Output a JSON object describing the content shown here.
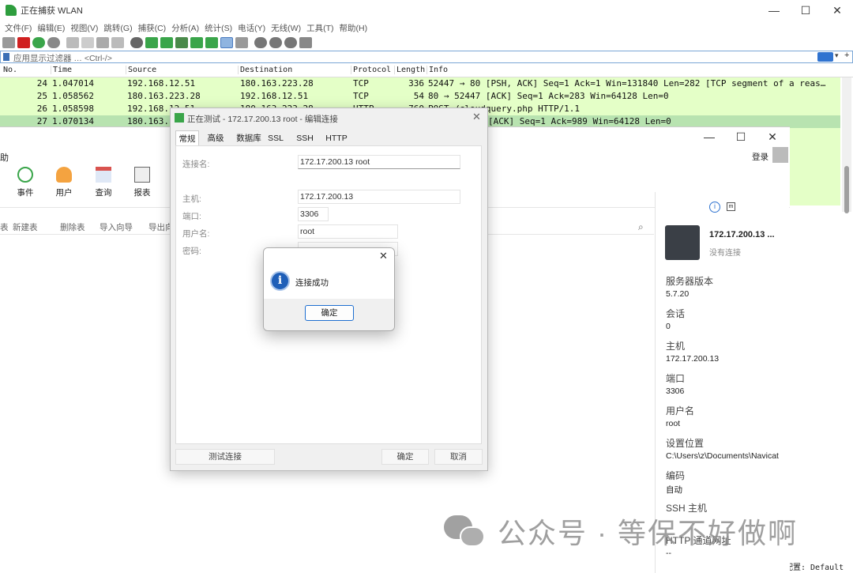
{
  "wireshark": {
    "title": "正在捕获 WLAN",
    "menu": [
      "文件(F)",
      "编辑(E)",
      "视图(V)",
      "跳转(G)",
      "捕获(C)",
      "分析(A)",
      "统计(S)",
      "电话(Y)",
      "无线(W)",
      "工具(T)",
      "帮助(H)"
    ],
    "filter_placeholder": "应用显示过滤器 … <Ctrl-/>",
    "columns": [
      "No.",
      "Time",
      "Source",
      "Destination",
      "Protocol",
      "Length",
      "Info"
    ],
    "packets": [
      {
        "no": "24",
        "time": "1.047014",
        "src": "192.168.12.51",
        "dst": "180.163.223.28",
        "proto": "TCP",
        "len": "336",
        "info": "52447 → 80 [PSH, ACK] Seq=1 Ack=1 Win=131840 Len=282 [TCP segment of a reas…"
      },
      {
        "no": "25",
        "time": "1.058562",
        "src": "180.163.223.28",
        "dst": "192.168.12.51",
        "proto": "TCP",
        "len": "54",
        "info": "80 → 52447 [ACK] Seq=1 Ack=283 Win=64128 Len=0"
      },
      {
        "no": "26",
        "time": "1.058598",
        "src": "192.168.12.51",
        "dst": "180.163.223.28",
        "proto": "HTTP",
        "len": "760",
        "info": "POST /cloudquery.php HTTP/1.1"
      },
      {
        "no": "27",
        "time": "1.070134",
        "src": "180.163.",
        "dst": "",
        "proto": "",
        "len": "",
        "info": "[ACK] Seq=1 Ack=989 Win=64128 Len=0"
      }
    ],
    "status_right": "配置: Default"
  },
  "navicat": {
    "left_title_fragment": "助",
    "login_label": "登录",
    "toolbar": [
      {
        "label": "事件",
        "icon": "clock-icon"
      },
      {
        "label": "用户",
        "icon": "user-icon"
      },
      {
        "label": "查询",
        "icon": "calendar-icon"
      },
      {
        "label": "报表",
        "icon": "report-icon"
      }
    ],
    "objbar": [
      "表",
      "新建表",
      "删除表",
      "导入向导",
      "导出向"
    ],
    "info": {
      "conn_name": "172.17.200.13 ...",
      "conn_status": "没有连接",
      "fields": [
        {
          "label": "服务器版本",
          "value": "5.7.20"
        },
        {
          "label": "会话",
          "value": "0"
        },
        {
          "label": "主机",
          "value": "172.17.200.13"
        },
        {
          "label": "端口",
          "value": "3306"
        },
        {
          "label": "用户名",
          "value": "root"
        },
        {
          "label": "设置位置",
          "value": "C:\\Users\\z\\Documents\\Navicat"
        },
        {
          "label": "编码",
          "value": "自动"
        },
        {
          "label": "SSH 主机",
          "value": ""
        },
        {
          "label": "HTTP 通道网址",
          "value": "--"
        }
      ]
    }
  },
  "dialog": {
    "title": "正在测试 - 172.17.200.13 root - 编辑连接",
    "tabs": [
      "常规",
      "高级",
      "数据库",
      "SSL",
      "SSH",
      "HTTP"
    ],
    "fields": {
      "conn_name_label": "连接名:",
      "conn_name_value": "172.17.200.13 root",
      "host_label": "主机:",
      "host_value": "172.17.200.13",
      "port_label": "端口:",
      "port_value": "3306",
      "user_label": "用户名:",
      "user_value": "root",
      "pass_label": "密码:",
      "pass_value": "●●●●●●●●"
    },
    "test_button": "测试连接",
    "ok_button": "确定",
    "cancel_button": "取消"
  },
  "message": {
    "text": "连接成功",
    "ok": "确定"
  },
  "watermark": "公众号 · 等保不好做啊"
}
